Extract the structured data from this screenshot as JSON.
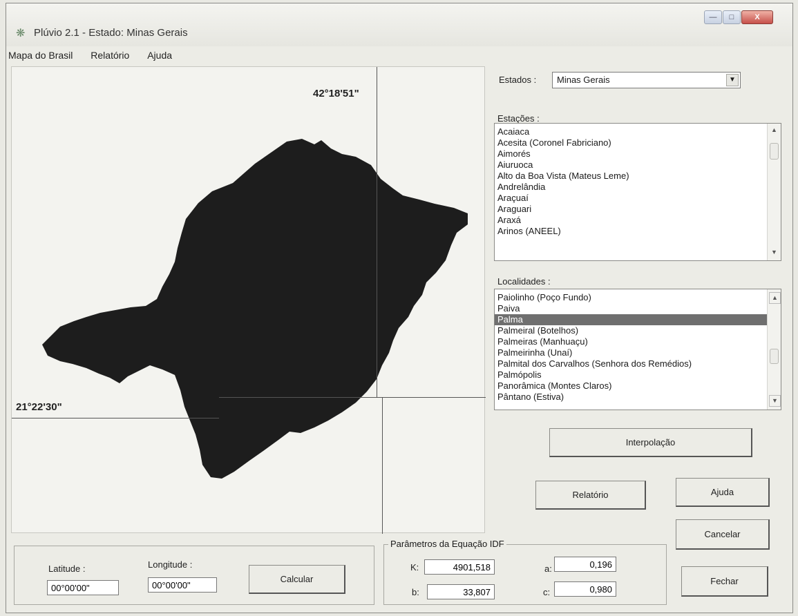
{
  "window": {
    "title": "Plúvio 2.1 - Estado: Minas Gerais",
    "controls": [
      "—",
      "□",
      "X"
    ]
  },
  "menu": [
    {
      "label": "Mapa do Brasil"
    },
    {
      "label": "Relatório"
    },
    {
      "label": "Ajuda"
    }
  ],
  "map": {
    "longitude_label": "42°18'51\"",
    "latitude_label": "21°22'30\"",
    "state_color": "#1d1d1d"
  },
  "estados": {
    "label": "Estados :",
    "selected": "Minas Gerais"
  },
  "estacoes": {
    "label": "Estações :",
    "items": [
      "Acaiaca",
      "Acesita (Coronel Fabriciano)",
      "Aimorés",
      "Aiuruoca",
      "Alto da Boa Vista (Mateus Leme)",
      "Andrelândia",
      "Araçuaí",
      "Araguari",
      "Araxá",
      "Arinos (ANEEL)"
    ]
  },
  "localidades": {
    "label": "Localidades :",
    "items": [
      "Paiolinho (Poço Fundo)",
      "Paiva",
      "Palma",
      "Palmeiral (Botelhos)",
      "Palmeiras (Manhuaçu)",
      "Palmeirinha (Unaí)",
      "Palmital dos Carvalhos (Senhora dos Remédios)",
      "Palmópolis",
      "Panorâmica (Montes Claros)",
      "Pântano (Estiva)"
    ],
    "selected_index": 2
  },
  "buttons": {
    "interpolacao": "Interpolação",
    "relatorio": "Relatório",
    "ajuda": "Ajuda",
    "cancelar": "Cancelar",
    "fechar": "Fechar",
    "calcular": "Calcular"
  },
  "coords": {
    "latitude_label": "Latitude :",
    "latitude_value": "00°00'00\"",
    "longitude_label": "Longitude :",
    "longitude_value": "00°00'00\""
  },
  "idf": {
    "title": "Parâmetros da Equação IDF",
    "k_label": "K:",
    "k_value": "4901,518",
    "b_label": "b:",
    "b_value": "33,807",
    "a_label": "a:",
    "a_value": "0,196",
    "c_label": "c:",
    "c_value": "0,980"
  }
}
